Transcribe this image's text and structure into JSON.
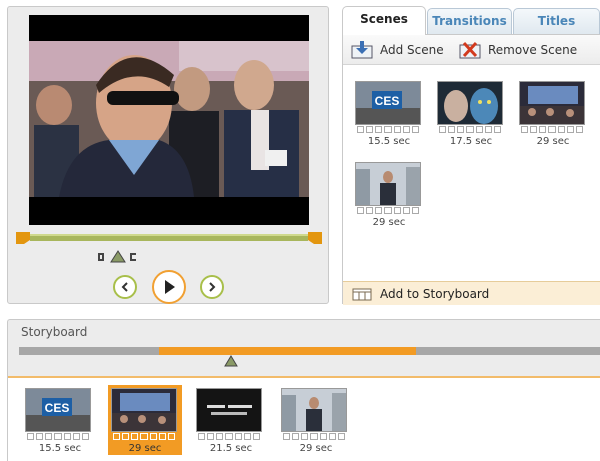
{
  "tabs": [
    {
      "label": "Scenes"
    },
    {
      "label": "Transitions"
    },
    {
      "label": "Titles"
    }
  ],
  "toolbar": {
    "add_scene": "Add Scene",
    "remove_scene": "Remove Scene"
  },
  "scenes": [
    {
      "duration": "15.5 sec",
      "thumbnail": "ces-logo"
    },
    {
      "duration": "17.5 sec",
      "thumbnail": "avatar-face"
    },
    {
      "duration": "29 sec",
      "thumbnail": "crowd-screen"
    },
    {
      "duration": "29 sec",
      "thumbnail": "man-outdoors"
    }
  ],
  "add_to_storyboard": "Add to Storyboard",
  "storyboard": {
    "title": "Storyboard",
    "clips": [
      {
        "duration": "15.5 sec",
        "thumbnail": "ces-logo"
      },
      {
        "duration": "29 sec",
        "thumbnail": "crowd-screen",
        "selected": true
      },
      {
        "duration": "21.5 sec",
        "thumbnail": "dark-text"
      },
      {
        "duration": "29 sec",
        "thumbnail": "man-outdoors"
      }
    ]
  },
  "colors": {
    "accent_orange": "#f29b24",
    "accent_green": "#a8bf4a",
    "tab_text": "#4a86b8"
  },
  "icons": {
    "prev": "chevron-left-icon",
    "play": "play-icon",
    "next": "chevron-right-icon",
    "add_scene": "add-scene-icon",
    "remove_scene": "remove-scene-icon",
    "add_storyboard": "add-storyboard-icon"
  }
}
